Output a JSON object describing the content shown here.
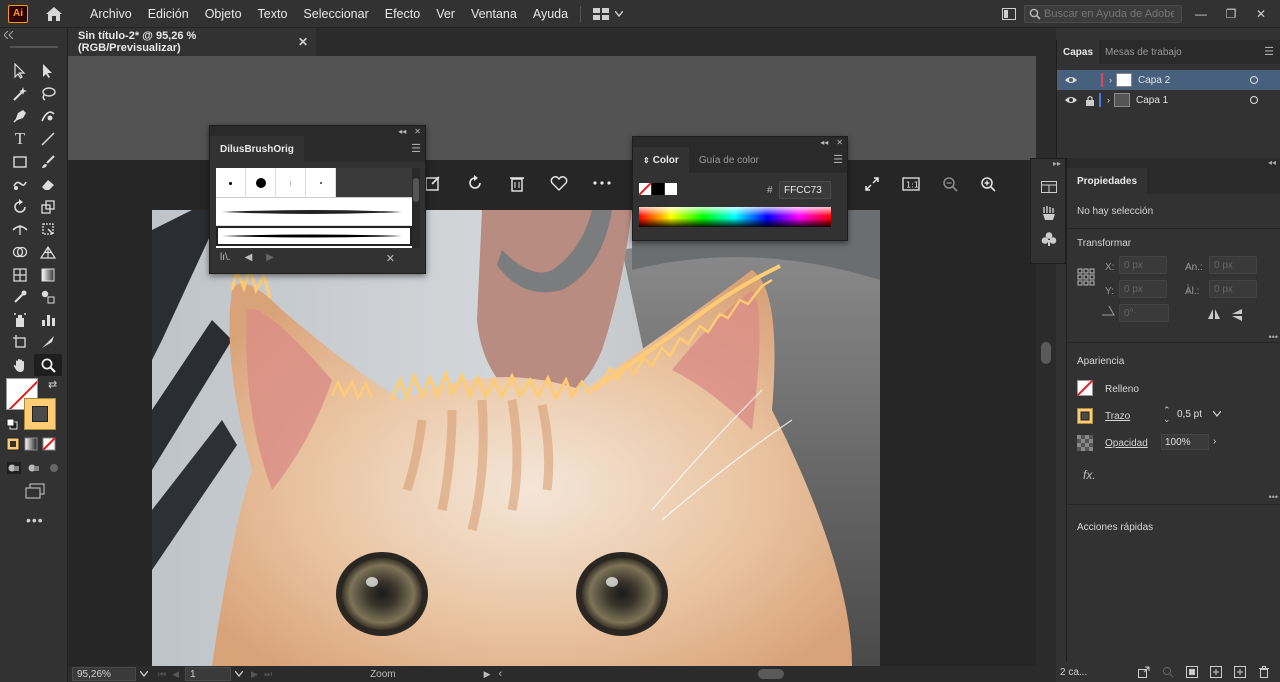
{
  "app": {
    "logo": "Ai",
    "menu": [
      "Archivo",
      "Edición",
      "Objeto",
      "Texto",
      "Seleccionar",
      "Efecto",
      "Ver",
      "Ventana",
      "Ayuda"
    ],
    "search_placeholder": "Buscar en Ayuda de Adobe",
    "minimize": "—",
    "restore": "❐",
    "close": "✕"
  },
  "document": {
    "tab_title": "Sin título-2* @ 95,26 % (RGB/Previsualizar)",
    "close_symbol": "✕"
  },
  "brush_panel": {
    "tab": "DilusBrushOrig"
  },
  "color_panel": {
    "tabs": [
      "Color",
      "Guía de color"
    ],
    "hash": "#",
    "hex_value": "FFCC73"
  },
  "layers_panel": {
    "tabs": [
      "Capas",
      "Mesas de trabajo"
    ],
    "layers": [
      {
        "name": "Capa 2",
        "color": "#e0445a",
        "selected": true
      },
      {
        "name": "Capa 1",
        "color": "#4b7be5",
        "selected": false
      }
    ],
    "footer_count": "2 ca..."
  },
  "properties_panel": {
    "tab": "Propiedades",
    "no_selection": "No hay selección",
    "transform_title": "Transformar",
    "x_label": "X:",
    "y_label": "Y:",
    "w_label": "An.:",
    "h_label": "Al.:",
    "x_placeholder": "0 px",
    "y_placeholder": "0 px",
    "w_placeholder": "0 px",
    "h_placeholder": "0 px",
    "angle_placeholder": "0°",
    "appearance_title": "Apariencia",
    "fill_label": "Relleno",
    "stroke_label": "Trazo",
    "stroke_value": "0,5 pt",
    "opacity_label": "Opacidad",
    "opacity_value": "100%",
    "fx_label": "fx.",
    "quick_actions_title": "Acciones rápidas"
  },
  "status": {
    "zoom": "95,26%",
    "artboard": "1",
    "tool_name": "Zoom"
  },
  "colors": {
    "stroke": "#ffcc73",
    "accent_selected_row": "#46607e"
  }
}
